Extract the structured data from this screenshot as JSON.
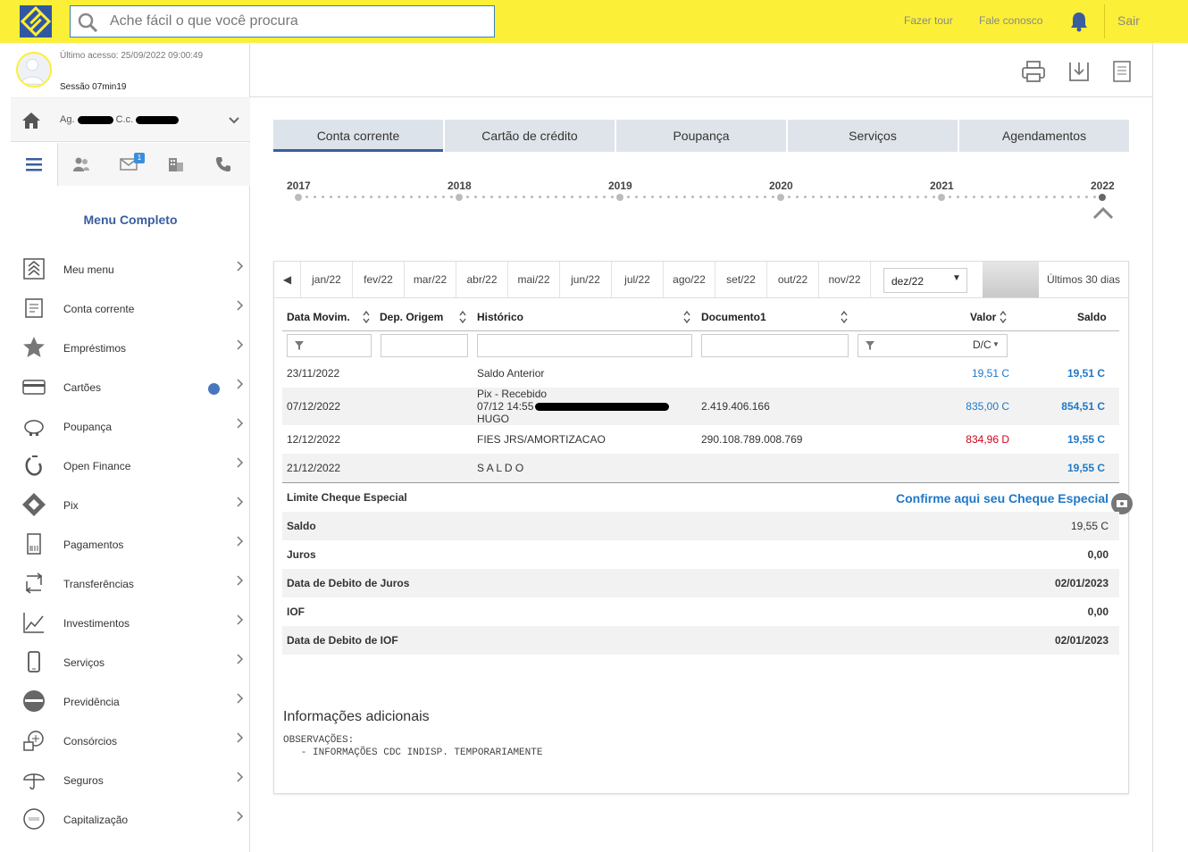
{
  "header": {
    "search_placeholder": "Ache fácil o que você procura",
    "links": [
      "Fazer tour",
      "Fale conosco"
    ],
    "logout": "Sair"
  },
  "sidebar": {
    "last_access": "Último acesso: 25/09/2022 09:00:49",
    "session": "Sessão 07min19",
    "agency_prefix": "Ag.",
    "account_prefix": "C.c.",
    "messages_badge": "1",
    "menu_title": "Menu Completo",
    "items": [
      {
        "label": "Meu menu",
        "icon": "bank-logo-icon"
      },
      {
        "label": "Conta corrente",
        "icon": "statement-icon"
      },
      {
        "label": "Empréstimos",
        "icon": "star-money-icon"
      },
      {
        "label": "Cartões",
        "icon": "card-icon",
        "notification": true
      },
      {
        "label": "Poupança",
        "icon": "piggy-bank-icon"
      },
      {
        "label": "Open Finance",
        "icon": "open-finance-icon"
      },
      {
        "label": "Pix",
        "icon": "pix-icon"
      },
      {
        "label": "Pagamentos",
        "icon": "barcode-icon"
      },
      {
        "label": "Transferências",
        "icon": "transfer-icon"
      },
      {
        "label": "Investimentos",
        "icon": "chart-icon"
      },
      {
        "label": "Serviços",
        "icon": "phone-icon"
      },
      {
        "label": "Previdência",
        "icon": "previdencia-icon"
      },
      {
        "label": "Consórcios",
        "icon": "consorcio-icon"
      },
      {
        "label": "Seguros",
        "icon": "umbrella-icon"
      },
      {
        "label": "Capitalização",
        "icon": "capitalizacao-icon"
      }
    ]
  },
  "tabs": [
    "Conta corrente",
    "Cartão de crédito",
    "Poupança",
    "Serviços",
    "Agendamentos"
  ],
  "timeline_years": [
    "2017",
    "2018",
    "2019",
    "2020",
    "2021",
    "2022"
  ],
  "months": [
    "jan/22",
    "fev/22",
    "mar/22",
    "abr/22",
    "mai/22",
    "jun/22",
    "jul/22",
    "ago/22",
    "set/22",
    "out/22",
    "nov/22"
  ],
  "month_selected": "dez/22",
  "last_30_days": "Últimos 30 dias",
  "table": {
    "headers": [
      "Data Movim.",
      "Dep. Origem",
      "Histórico",
      "Documento1",
      "Valor",
      "Saldo"
    ],
    "dc_filter": "D/C",
    "rows": [
      {
        "date": "23/11/2022",
        "hist": "Saldo Anterior",
        "doc": "",
        "valor": "19,51 C",
        "saldo": "19,51 C"
      },
      {
        "date": "07/12/2022",
        "hist1": "Pix - Recebido",
        "hist2": "07/12 14:55",
        "hist3": "HUGO",
        "doc": "2.419.406.166",
        "valor": "835,00 C",
        "saldo": "854,51 C"
      },
      {
        "date": "12/12/2022",
        "hist": "FIES JRS/AMORTIZACAO",
        "doc": "290.108.789.008.769",
        "valor": "834,96 D",
        "saldo": "19,55 C"
      },
      {
        "date": "21/12/2022",
        "hist": "S A L D O",
        "doc": "",
        "valor": "",
        "saldo": "19,55 C"
      }
    ]
  },
  "summary": {
    "limite_label": "Limite Cheque Especial",
    "cheque_link": "Confirme aqui seu Cheque Especial",
    "rows": [
      {
        "label": "Saldo",
        "value": "19,55 C"
      },
      {
        "label": "Juros",
        "value": "0,00"
      },
      {
        "label": "Data de Debito de Juros",
        "value": "02/01/2023"
      },
      {
        "label": "IOF",
        "value": "0,00"
      },
      {
        "label": "Data de Debito de IOF",
        "value": "02/01/2023"
      }
    ]
  },
  "info": {
    "title": "Informações adicionais",
    "obs_line1": "OBSERVAÇÕES:",
    "obs_line2": "   - INFORMAÇÕES CDC INDISP. TEMPORARIAMENTE"
  },
  "colors": {
    "brand_yellow": "#fcef38",
    "brand_blue": "#3a5d9f",
    "credit_blue": "#1f78c8",
    "debit_red": "#d0021b"
  }
}
